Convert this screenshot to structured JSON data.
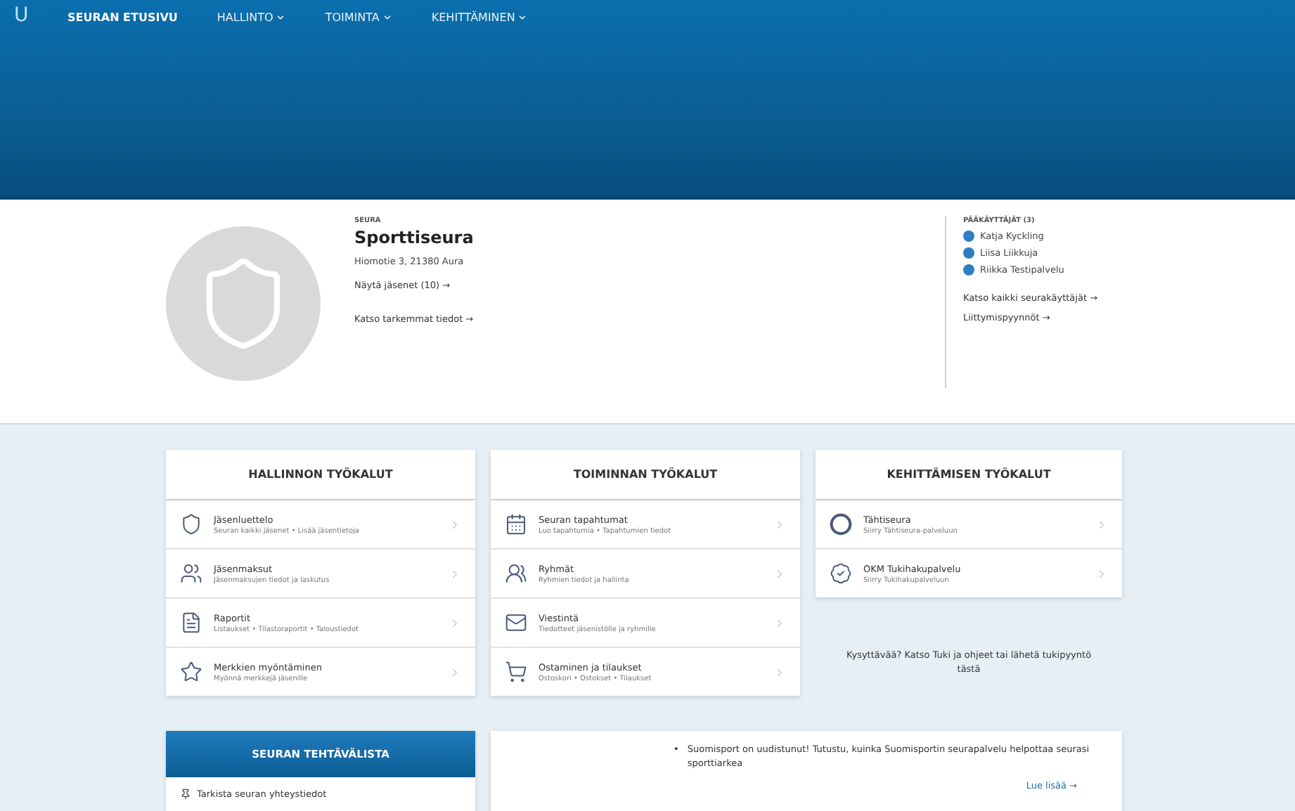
{
  "nav": {
    "logo": "U",
    "items": [
      {
        "label": "SEURAN ETUSIVU",
        "dropdown": false,
        "selected": true
      },
      {
        "label": "HALLINTO",
        "dropdown": true,
        "selected": false
      },
      {
        "label": "TOIMINTA",
        "dropdown": true,
        "selected": false
      },
      {
        "label": "KEHITTÄMINEN",
        "dropdown": true,
        "selected": false
      }
    ]
  },
  "club": {
    "kicker": "SEURA",
    "name": "Sporttiseura",
    "address": "Hiomotie 3, 21380 Aura",
    "links": [
      "Näytä jäsenet (10) →",
      "Katso tarkemmat tiedot →"
    ]
  },
  "admins": {
    "title": "PÄÄKÄYTTÄJÄT (3)",
    "people": [
      "Katja Kyckling",
      "Liisa Liikkuja",
      "Riikka Testipalvelu"
    ],
    "links": [
      "Katso kaikki seurakäyttäjät →",
      "Liittymispyynnöt →"
    ]
  },
  "tool_cards": [
    {
      "title": "HALLINNON TYÖKALUT",
      "items": [
        {
          "title": "Jäsenluettelo",
          "subtitle": "Seuran kaikki jäsenet • Lisää jäsentietoja"
        },
        {
          "title": "Jäsenmaksut",
          "subtitle": "Jäsenmaksujen tiedot ja laskutus"
        },
        {
          "title": "Raportit",
          "subtitle": "Listaukset • Tilastoraportit • Taloustiedot"
        },
        {
          "title": "Merkkien myöntäminen",
          "subtitle": "Myönnä merkkejä jäsenille"
        }
      ]
    },
    {
      "title": "TOIMINNAN TYÖKALUT",
      "items": [
        {
          "title": "Seuran tapahtumat",
          "subtitle": "Luo tapahtumia • Tapahtumien tiedot"
        },
        {
          "title": "Ryhmät",
          "subtitle": "Ryhmien tiedot ja hallinta"
        },
        {
          "title": "Viestintä",
          "subtitle": "Tiedotteet jäsenistölle ja ryhmille"
        },
        {
          "title": "Ostaminen ja tilaukset",
          "subtitle": "Ostoskori • Ostokset • Tilaukset"
        }
      ]
    },
    {
      "title": "KEHITTÄMISEN TYÖKALUT",
      "items": [
        {
          "title": "Tähtiseura",
          "subtitle": "Siirry Tähtiseura-palveluun"
        },
        {
          "title": "OKM Tukihakupalvelu",
          "subtitle": "Siirry Tukihakupalveluun"
        }
      ]
    }
  ],
  "support_text": "Kysyttävää? Katso Tuki ja ohjeet tai lähetä tukipyyntö tästä",
  "task_list": {
    "title": "SEURAN TEHTÄVÄLISTA",
    "tasks": [
      "Tarkista seuran yhteystiedot"
    ]
  },
  "news": {
    "bullet": "•",
    "items": [
      "Suomisport on uudistunut! Tutustu, kuinka Suomisportin seurapalvelu helpottaa seurasi sporttiarkea"
    ],
    "link": "Lue lisää →"
  }
}
